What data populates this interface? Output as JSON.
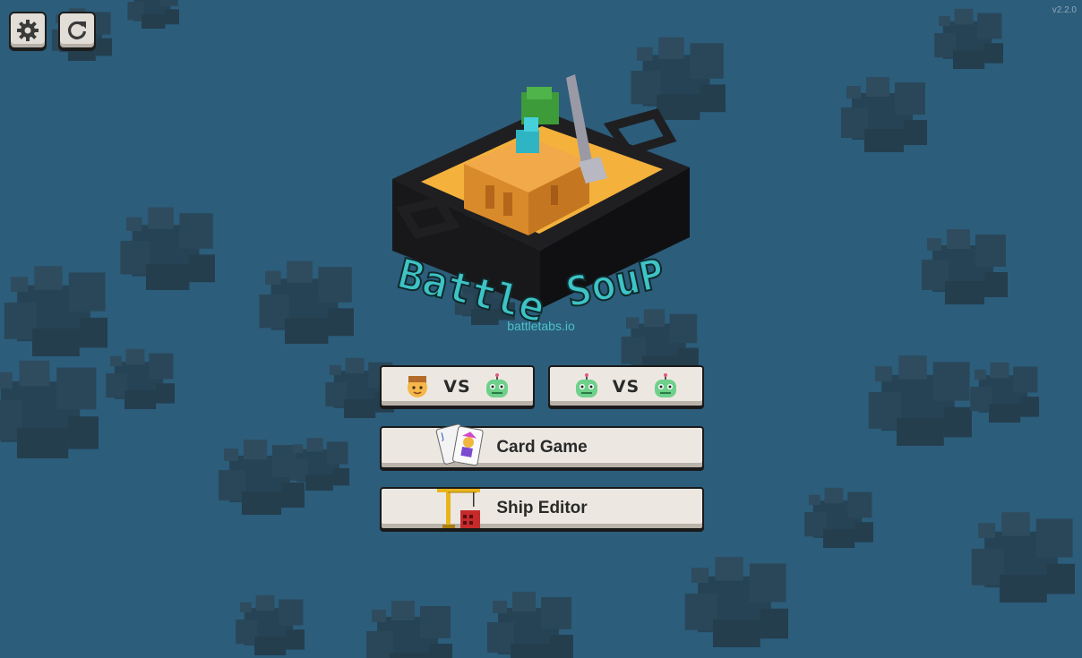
{
  "version": "v2.2.0",
  "logo": {
    "title_word1": "Battle",
    "title_word2": "SouP",
    "site": "battletabs.io"
  },
  "toolbar": {
    "settings_icon": "gear-icon",
    "restart_icon": "refresh-icon"
  },
  "menu": {
    "vs_ai": {
      "player": "boy-face-icon",
      "vs_label": "VS",
      "opponent": "robot-icon"
    },
    "ai_vs_ai": {
      "player": "robot-icon",
      "vs_label": "VS",
      "opponent": "robot-icon"
    },
    "card_game": {
      "label": "Card Game",
      "icon": "playing-cards-icon"
    },
    "ship_editor": {
      "label": "Ship Editor",
      "icon": "construction-crane-icon"
    }
  },
  "colors": {
    "background": "#2c5d7b",
    "button_face": "#ece8e1",
    "accent_teal": "#4cc2c6",
    "sand": "#f4b13c"
  }
}
